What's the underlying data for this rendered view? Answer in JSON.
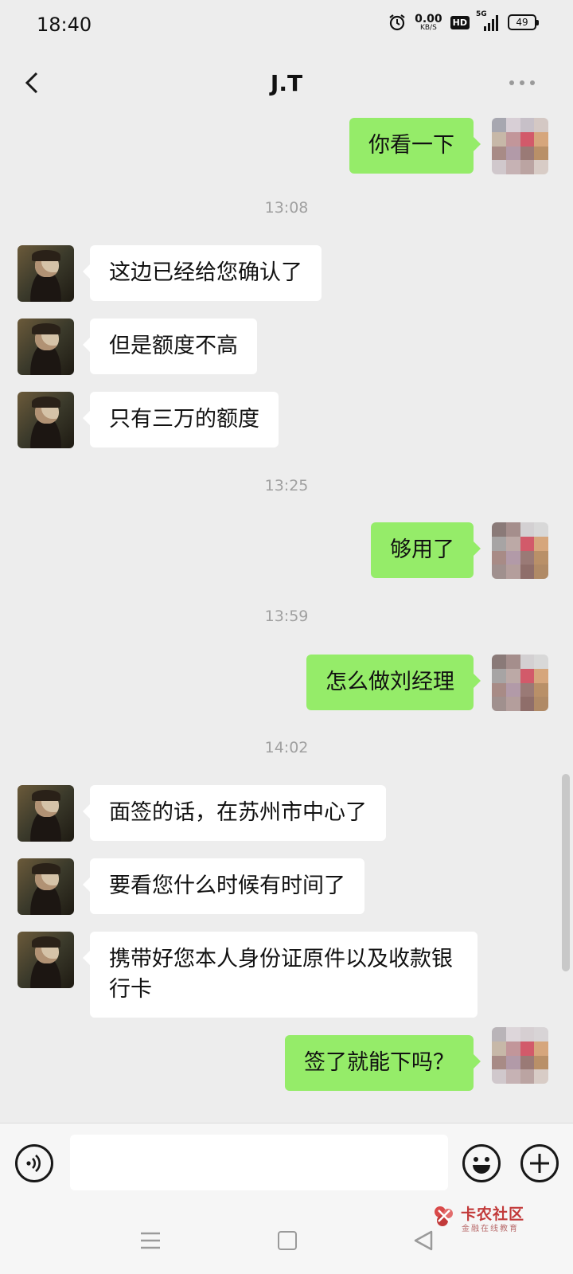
{
  "status_bar": {
    "time": "18:40",
    "net_speed_value": "0.00",
    "net_speed_unit": "KB/S",
    "hd_label": "HD",
    "signal_label": "5G",
    "battery_level": "49"
  },
  "header": {
    "title": "J.T"
  },
  "chat": {
    "ts1": "13:08",
    "ts2": "13:25",
    "ts3": "13:59",
    "ts4": "14:02",
    "messages": [
      {
        "side": "right",
        "text": "你看一下"
      },
      {
        "side": "left",
        "text": "这边已经给您确认了"
      },
      {
        "side": "left",
        "text": "但是额度不高"
      },
      {
        "side": "left",
        "text": "只有三万的额度"
      },
      {
        "side": "right",
        "text": "够用了"
      },
      {
        "side": "right",
        "text": "怎么做刘经理"
      },
      {
        "side": "left",
        "text": "面签的话，在苏州市中心了"
      },
      {
        "side": "left",
        "text": "要看您什么时候有时间了"
      },
      {
        "side": "left",
        "text": "携带好您本人身份证原件以及收款银行卡"
      },
      {
        "side": "right",
        "text": "签了就能下吗？"
      }
    ]
  },
  "input_bar": {
    "value": ""
  },
  "watermark": {
    "title": "卡农社区",
    "subtitle": "金融在线教育"
  },
  "colors": {
    "background": "#ededed",
    "outgoing_bubble": "#95ec69",
    "incoming_bubble": "#ffffff",
    "watermark": "#c23a3a"
  },
  "icons": [
    "back-icon",
    "more-icon",
    "voice-icon",
    "emoji-icon",
    "plus-icon",
    "menu-icon",
    "home-icon",
    "nav-back-icon"
  ]
}
